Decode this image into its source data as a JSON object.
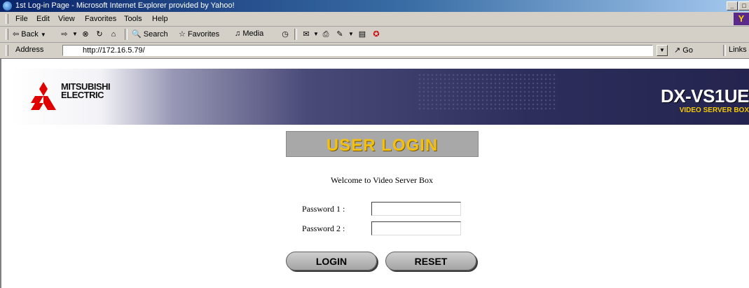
{
  "window": {
    "title": "1st Log-in Page - Microsoft Internet Explorer provided by Yahoo!"
  },
  "menubar": {
    "items": [
      "File",
      "Edit",
      "View",
      "Favorites",
      "Tools",
      "Help"
    ]
  },
  "toolbar": {
    "back": "Back",
    "search": "Search",
    "favorites": "Favorites",
    "media": "Media"
  },
  "addressbar": {
    "label": "Address",
    "url": "http://172.16.5.79/",
    "go": "Go",
    "links": "Links"
  },
  "banner": {
    "brand_line1": "MITSUBISHI",
    "brand_line2": "ELECTRIC",
    "model": "DX-VS1UE",
    "model_subtitle": "VIDEO SERVER BOX"
  },
  "login": {
    "heading": "USER LOGIN",
    "welcome": "Welcome to Video Server Box",
    "password1_label": "Password 1 :",
    "password1_value": "",
    "password2_label": "Password 2 :",
    "password2_value": "",
    "login_button": "LOGIN",
    "reset_button": "RESET"
  },
  "colors": {
    "titlebar": "#0a246a",
    "banner_dark": "#24244f",
    "login_heading": "#f2c010",
    "model_subtitle": "#f4c800",
    "logo_red": "#e00000"
  }
}
